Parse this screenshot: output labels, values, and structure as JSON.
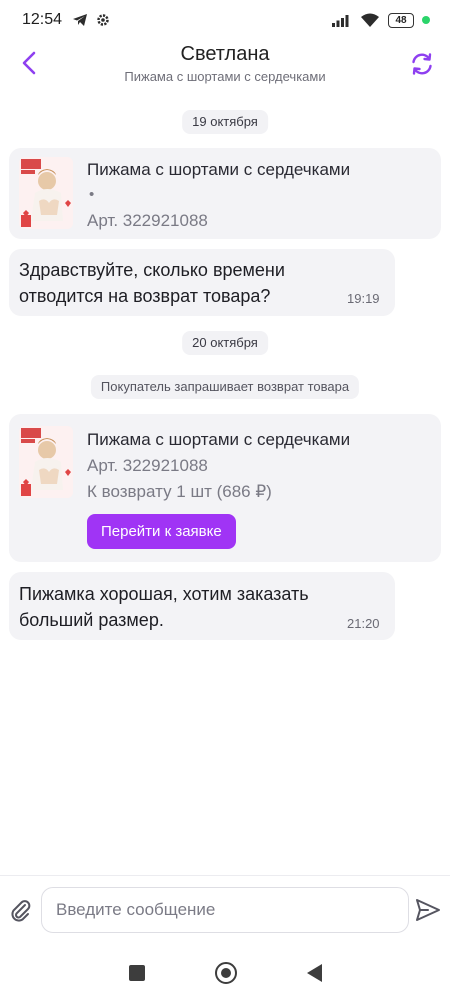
{
  "status_bar": {
    "time": "12:54",
    "battery": "48",
    "icons": [
      "telegram-icon",
      "gear-icon",
      "signal-icon",
      "wifi-icon"
    ]
  },
  "header": {
    "title": "Светлана",
    "subtitle": "Пижама с шортами с сердечками",
    "back_icon": "chevron-left-icon",
    "refresh_icon": "refresh-icon"
  },
  "chat": {
    "date1": "19 октября",
    "product_card": {
      "title": "Пижама с шортами с сердечками",
      "dot": "•",
      "article": "Арт. 322921088"
    },
    "message1": {
      "text": "Здравствуйте, сколько времени отводится на возврат товара?",
      "time": "19:19"
    },
    "date2": "20 октября",
    "system_note": "Покупатель запрашивает возврат товара",
    "return_card": {
      "title": "Пижама с шортами с сердечками",
      "article": "Арт. 322921088",
      "return_info": "К возврату 1 шт (686 ₽)",
      "button": "Перейти к заявке"
    },
    "message2": {
      "text": "Пижамка хорошая, хотим заказать больший размер.",
      "time": "21:20"
    }
  },
  "composer": {
    "placeholder": "Введите сообщение",
    "attach_icon": "paperclip-icon",
    "send_icon": "send-icon"
  },
  "colors": {
    "accent": "#a034f5",
    "card_bg": "#f3f3f6",
    "chip_bg": "#f2f2f5"
  }
}
